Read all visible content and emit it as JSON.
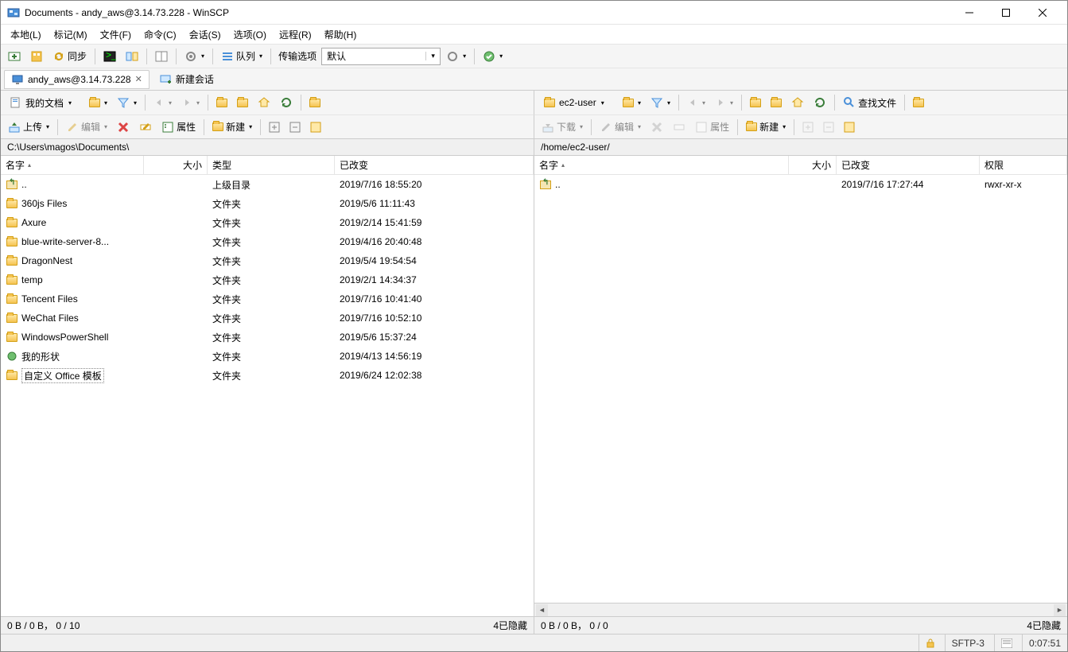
{
  "window": {
    "title": "Documents - andy_aws@3.14.73.228 - WinSCP"
  },
  "menu": {
    "items": [
      "本地(L)",
      "标记(M)",
      "文件(F)",
      "命令(C)",
      "会话(S)",
      "选项(O)",
      "远程(R)",
      "帮助(H)"
    ]
  },
  "main_toolbar": {
    "sync": "同步",
    "queue": "队列",
    "transfer_label": "传输选项",
    "transfer_value": "默认"
  },
  "sessions": {
    "active": "andy_aws@3.14.73.228",
    "new": "新建会话"
  },
  "left": {
    "folder": "我的文档",
    "actions": {
      "upload": "上传",
      "edit": "编辑",
      "props": "属性",
      "new": "新建"
    },
    "path": "C:\\Users\\magos\\Documents\\",
    "columns": {
      "name": "名字",
      "size": "大小",
      "type": "类型",
      "changed": "已改变"
    },
    "rows": [
      {
        "icon": "up",
        "name": "..",
        "type": "上级目录",
        "changed": "2019/7/16  18:55:20"
      },
      {
        "icon": "folder",
        "name": "360js Files",
        "type": "文件夹",
        "changed": "2019/5/6  11:11:43"
      },
      {
        "icon": "folder",
        "name": "Axure",
        "type": "文件夹",
        "changed": "2019/2/14  15:41:59"
      },
      {
        "icon": "folder",
        "name": "blue-write-server-8...",
        "type": "文件夹",
        "changed": "2019/4/16  20:40:48"
      },
      {
        "icon": "folder",
        "name": "DragonNest",
        "type": "文件夹",
        "changed": "2019/5/4  19:54:54"
      },
      {
        "icon": "folder",
        "name": "temp",
        "type": "文件夹",
        "changed": "2019/2/1  14:34:37"
      },
      {
        "icon": "folder",
        "name": "Tencent Files",
        "type": "文件夹",
        "changed": "2019/7/16  10:41:40"
      },
      {
        "icon": "folder",
        "name": "WeChat Files",
        "type": "文件夹",
        "changed": "2019/7/16  10:52:10"
      },
      {
        "icon": "folder",
        "name": "WindowsPowerShell",
        "type": "文件夹",
        "changed": "2019/5/6  15:37:24"
      },
      {
        "icon": "shape",
        "name": "我的形状",
        "type": "文件夹",
        "changed": "2019/4/13  14:56:19"
      },
      {
        "icon": "folder",
        "name": "自定义 Office 模板",
        "type": "文件夹",
        "changed": "2019/6/24  12:02:38",
        "selected": true
      }
    ],
    "status_left": "0 B / 0 B， 0 / 10",
    "status_right": "4已隐藏"
  },
  "right": {
    "folder": "ec2-user",
    "find": "查找文件",
    "actions": {
      "download": "下载",
      "edit": "编辑",
      "props": "属性",
      "new": "新建"
    },
    "path": "/home/ec2-user/",
    "columns": {
      "name": "名字",
      "size": "大小",
      "changed": "已改变",
      "perm": "权限"
    },
    "rows": [
      {
        "icon": "up",
        "name": "..",
        "changed": "2019/7/16 17:27:44",
        "perm": "rwxr-xr-x"
      }
    ],
    "status_left": "0 B / 0 B， 0 / 0",
    "status_right": "4已隐藏"
  },
  "bottom": {
    "protocol": "SFTP-3",
    "time": "0:07:51"
  }
}
